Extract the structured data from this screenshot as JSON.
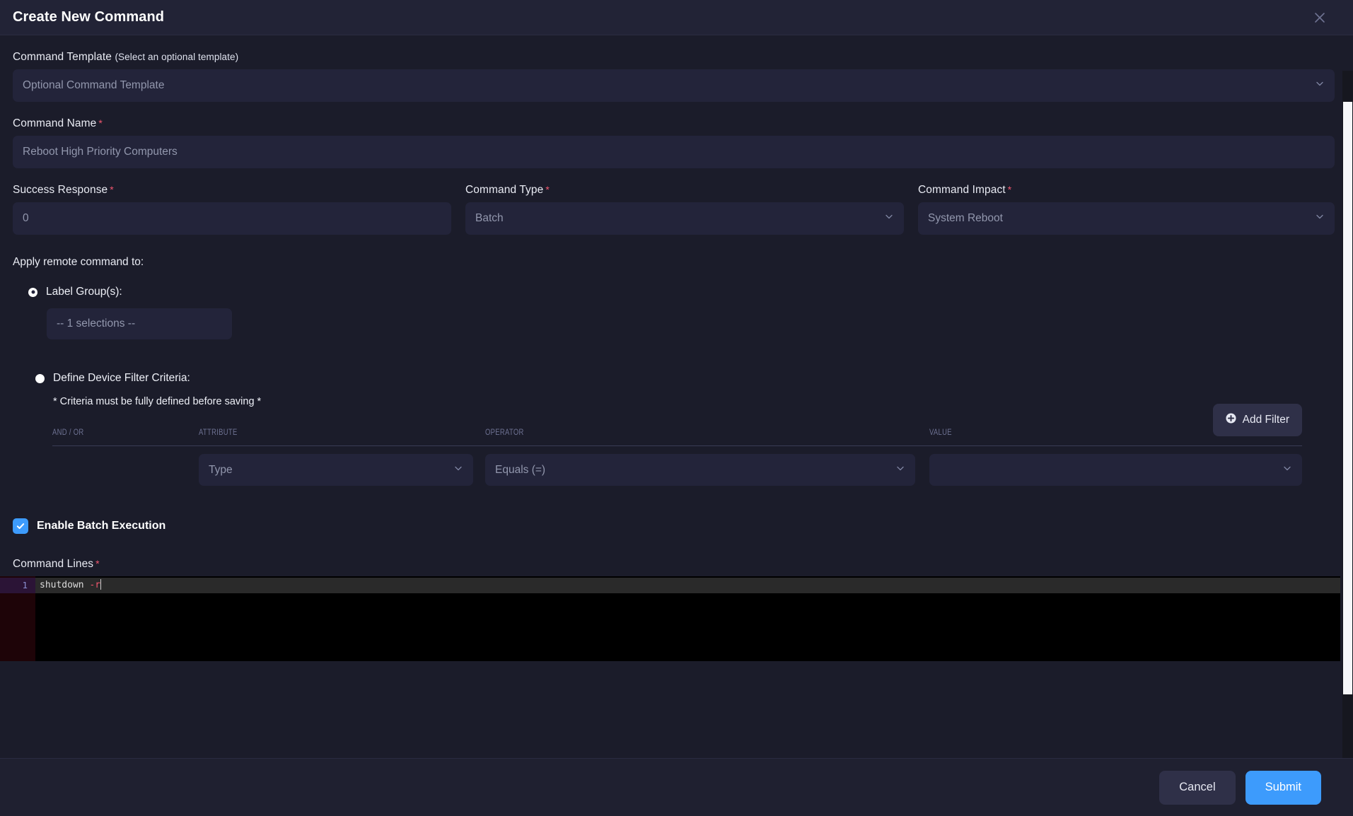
{
  "header": {
    "title": "Create New Command",
    "close_icon": "close-icon"
  },
  "form": {
    "template": {
      "label": "Command Template",
      "hint": "(Select an optional template)",
      "value": "Optional Command Template",
      "chevron_icon": "chevron-down-icon"
    },
    "command_name": {
      "label": "Command Name",
      "required_mark": "*",
      "value": "Reboot High Priority Computers"
    },
    "success_response": {
      "label": "Success Response",
      "required_mark": "*",
      "value": "0"
    },
    "command_type": {
      "label": "Command Type",
      "required_mark": "*",
      "value": "Batch",
      "chevron_icon": "chevron-down-icon"
    },
    "command_impact": {
      "label": "Command Impact",
      "required_mark": "*",
      "value": "System Reboot",
      "chevron_icon": "chevron-down-icon"
    },
    "apply_to_label": "Apply remote command to:",
    "label_groups": {
      "radio_label": "Label Group(s):",
      "selected": true,
      "selections_value": "-- 1 selections --"
    },
    "device_filter": {
      "radio_label": "Define Device Filter Criteria:",
      "selected": false,
      "note": "* Criteria must be fully defined before saving *",
      "add_filter_label": "Add Filter",
      "add_filter_icon": "plus-circle-icon",
      "columns": [
        "AND / OR",
        "ATTRIBUTE",
        "OPERATOR",
        "VALUE"
      ],
      "rows": [
        {
          "and_or": "",
          "attribute": "Type",
          "operator": "Equals (=)",
          "value": ""
        }
      ]
    },
    "batch_execution": {
      "label": "Enable Batch Execution",
      "checked": true,
      "check_icon": "check-icon"
    },
    "command_lines": {
      "label": "Command Lines",
      "required_mark": "*",
      "lines": [
        {
          "number": "1",
          "command": "shutdown",
          "flag": " -r"
        }
      ]
    }
  },
  "footer": {
    "cancel_label": "Cancel",
    "submit_label": "Submit"
  },
  "colors": {
    "accent_blue": "#3d9bfc",
    "required_red": "#f0566e",
    "modal_bg": "#1b1c2a",
    "input_bg": "#23243a",
    "header_bg": "#222336"
  }
}
